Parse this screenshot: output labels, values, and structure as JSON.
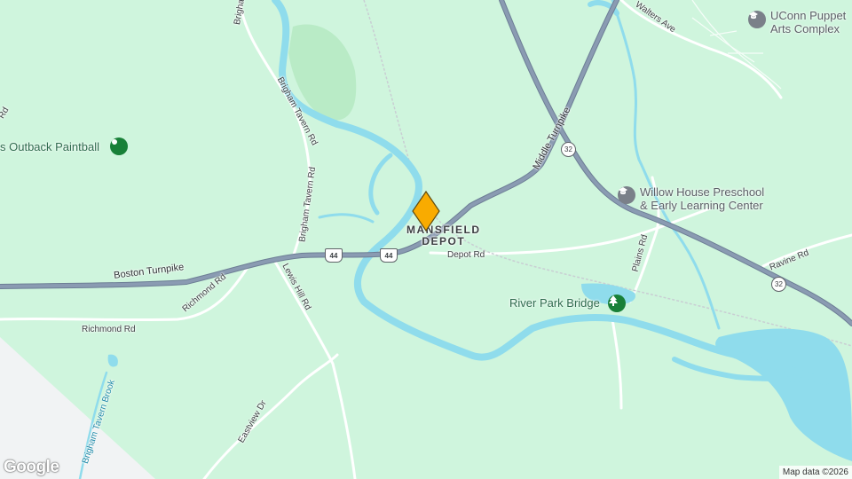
{
  "map": {
    "attribution": "Map data ©2026",
    "logo": "Google",
    "colors": {
      "land": "#cff5dd",
      "water": "#8fdcec",
      "highway": "#8a9bb2",
      "road": "#ffffff",
      "forest": "#b7ecc5",
      "marker": "#f9ab00",
      "poi_green": "#188038",
      "poi_gray": "#5f6368"
    }
  },
  "places": {
    "town_line1": "MANSFIELD",
    "town_line2": "DEPOT",
    "poi": [
      {
        "label": "UConn Puppet Arts Complex",
        "line1": "UConn Puppet",
        "line2": "Arts Complex",
        "icon": "education-icon"
      },
      {
        "label": "Willow House Preschool & Early Learning Center",
        "line1": "Willow House Preschool",
        "line2": "& Early Learning Center",
        "icon": "education-icon"
      },
      {
        "label": "River Park Bridge",
        "icon": "park-tree-icon"
      },
      {
        "label": "s Outback Paintball",
        "icon": "recreation-icon"
      }
    ]
  },
  "roads": {
    "boston_turnpike": "Boston Turnpike",
    "middle_turnpike": "Middle Turnpike",
    "richmond_rd_a": "Richmond Rd",
    "richmond_rd_b": "Richmond Rd",
    "brigham_tavern_rd_a": "Brigham Tavern Rd",
    "brigham_tavern_rd_b": "Brigham Tavern Rd",
    "brigham_top": "Brigham",
    "lewis_hill_rd": "Lewis Hill Rd",
    "depot_rd": "Depot Rd",
    "plains_rd": "Plains Rd",
    "ravine_rd": "Ravine Rd",
    "walters_ave": "Walters Ave",
    "eastview_dr": "Eastview Dr",
    "brigham_tavern_brook": "Brigham Tavern Brook",
    "left_edge_rd": "Rd"
  },
  "shields": {
    "us44_a": "44",
    "us44_b": "44",
    "rt32_a": "32",
    "rt32_b": "32"
  }
}
